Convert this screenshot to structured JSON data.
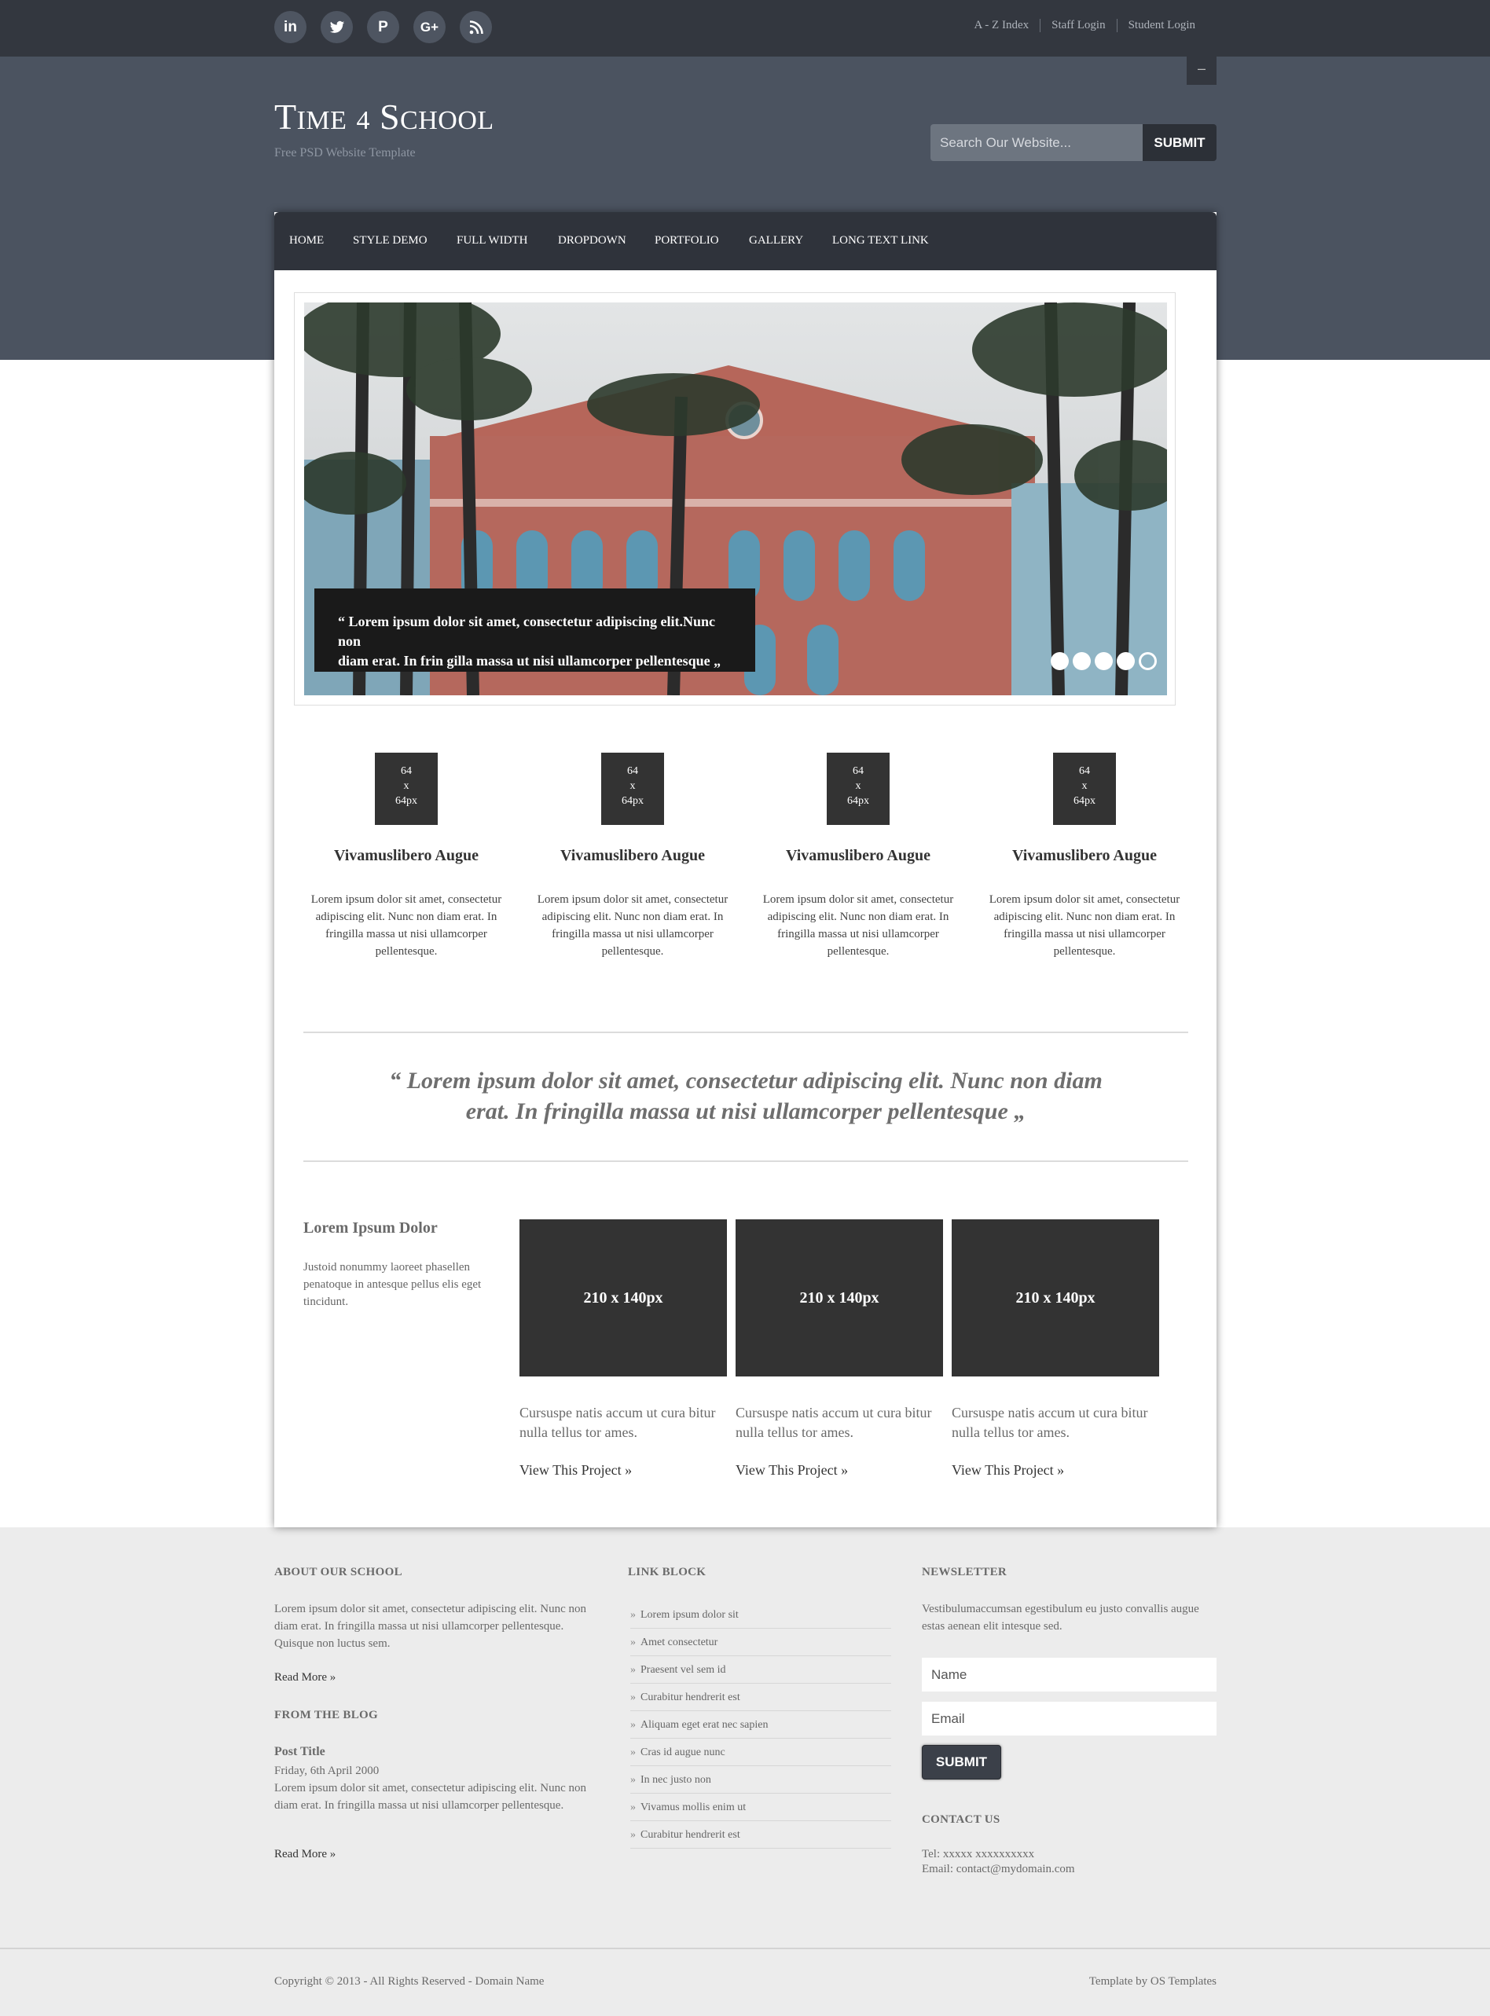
{
  "topbar": {
    "social": [
      "in",
      "t",
      "P",
      "G+",
      "rss"
    ],
    "links": [
      "A - Z Index",
      "Staff Login",
      "Student Login"
    ]
  },
  "header": {
    "toggle": "–",
    "logo_word1_initial": "T",
    "logo_word1_rest": "IME",
    "logo_mid": "4",
    "logo_word2_initial": "S",
    "logo_word2_rest": "CHOOL",
    "tagline": "Free PSD Website Template",
    "search_placeholder": "Search Our Website...",
    "search_button": "SUBMIT"
  },
  "nav": [
    "HOME",
    "STYLE DEMO",
    "FULL WIDTH",
    "DROPDOWN",
    "PORTFOLIO",
    "GALLERY",
    "LONG TEXT LINK"
  ],
  "slider": {
    "caption_line1": "“ Lorem ipsum dolor sit amet, consectetur adipiscing elit.Nunc non",
    "caption_line2": "diam erat. In frin gilla massa ut nisi ullamcorper pellentesque „",
    "dot_count": 5,
    "active_dot": 5
  },
  "features": [
    {
      "icon_line1": "64",
      "icon_line2": "x",
      "icon_line3": "64px",
      "title": "Vivamuslibero Augue",
      "text": "Lorem ipsum dolor sit amet, consectetur adipiscing elit. Nunc non diam erat. In fringilla massa ut nisi ullamcorper pellentesque."
    },
    {
      "icon_line1": "64",
      "icon_line2": "x",
      "icon_line3": "64px",
      "title": "Vivamuslibero Augue",
      "text": "Lorem ipsum dolor sit amet, consectetur adipiscing elit. Nunc non diam erat. In fringilla massa ut nisi ullamcorper pellentesque."
    },
    {
      "icon_line1": "64",
      "icon_line2": "x",
      "icon_line3": "64px",
      "title": "Vivamuslibero Augue",
      "text": "Lorem ipsum dolor sit amet, consectetur adipiscing elit. Nunc non diam erat. In fringilla massa ut nisi ullamcorper pellentesque."
    },
    {
      "icon_line1": "64",
      "icon_line2": "x",
      "icon_line3": "64px",
      "title": "Vivamuslibero Augue",
      "text": "Lorem ipsum dolor sit amet, consectetur adipiscing elit. Nunc non diam erat. In fringilla massa ut nisi ullamcorper pellentesque."
    }
  ],
  "quote": {
    "line1": "“ Lorem ipsum dolor sit amet, consectetur adipiscing elit. Nunc non diam",
    "line2": "erat. In fringilla massa ut nisi ullamcorper pellentesque „"
  },
  "portfolio": {
    "side_title": "Lorem Ipsum Dolor",
    "side_text": "Justoid nonummy laoreet phasellen penatoque in antesque pellus elis eget tincidunt.",
    "items": [
      {
        "thumb": "210 x 140px",
        "text": "Cursuspe natis accum ut cura bitur nulla tellus tor ames.",
        "link": "View This Project »"
      },
      {
        "thumb": "210 x 140px",
        "text": "Cursuspe natis accum ut cura bitur nulla tellus tor ames.",
        "link": "View This Project »"
      },
      {
        "thumb": "210 x 140px",
        "text": "Cursuspe natis accum ut cura bitur nulla tellus tor ames.",
        "link": "View This Project »"
      }
    ]
  },
  "footer": {
    "about_title": "ABOUT OUR SCHOOL",
    "about_text": "Lorem ipsum dolor sit amet, consectetur adipiscing elit. Nunc non diam erat. In fringilla massa ut nisi ullamcorper pellentesque. Quisque non luctus sem.",
    "about_link": "Read More »",
    "blog_title": "FROM THE BLOG",
    "post_title": "Post Title",
    "post_date": "Friday, 6th April 2000",
    "post_text": "Lorem ipsum dolor sit amet, consectetur adipiscing elit. Nunc non diam erat. In fringilla massa ut nisi ullamcorper pellentesque.",
    "post_link": "Read More »",
    "links_title": "LINK BLOCK",
    "links": [
      "Lorem ipsum dolor sit",
      "Amet consectetur",
      "Praesent vel sem id",
      "Curabitur hendrerit est",
      "Aliquam eget erat nec sapien",
      "Cras id augue nunc",
      "In nec justo non",
      "Vivamus mollis enim ut",
      "Curabitur hendrerit est"
    ],
    "newsletter_title": "NEWSLETTER",
    "newsletter_text": "Vestibulumaccumsan egestibulum eu justo convallis augue estas aenean elit intesque sed.",
    "name_placeholder": "Name",
    "email_placeholder": "Email",
    "submit": "SUBMIT",
    "contact_title": "CONTACT US",
    "tel": "Tel: xxxxx xxxxxxxxxx",
    "email": "Email: contact@mydomain.com",
    "copyright": "Copyright © 2013 - All Rights Reserved - Domain Name",
    "credit": "Template by OS Templates"
  }
}
